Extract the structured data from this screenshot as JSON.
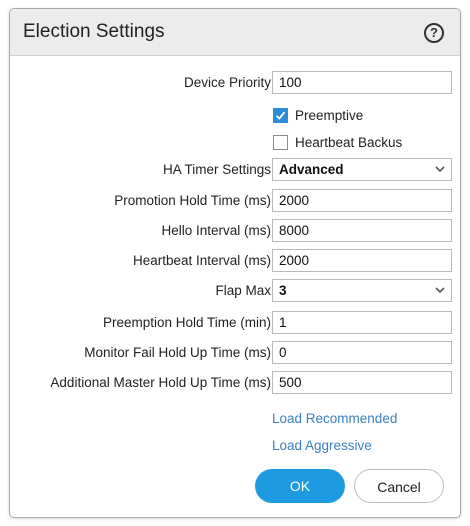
{
  "dialog": {
    "title": "Election Settings",
    "help_glyph": "?"
  },
  "fields": {
    "device_priority": {
      "label": "Device Priority",
      "value": "100"
    },
    "preemptive": {
      "label": "Preemptive",
      "checked": true
    },
    "heartbeat_backup": {
      "label": "Heartbeat Backus",
      "checked": false
    },
    "ha_timer_settings": {
      "label": "HA Timer Settings",
      "value": "Advanced"
    },
    "promotion_hold_time": {
      "label": "Promotion Hold Time (ms)",
      "value": "2000"
    },
    "hello_interval": {
      "label": "Hello Interval (ms)",
      "value": "8000"
    },
    "heartbeat_interval": {
      "label": "Heartbeat Interval (ms)",
      "value": "2000"
    },
    "flap_max": {
      "label": "Flap Max",
      "value": "3"
    },
    "preemption_hold_time": {
      "label": "Preemption Hold Time (min)",
      "value": "1"
    },
    "monitor_fail_hold_up_time": {
      "label": "Monitor Fail Hold Up Time (ms)",
      "value": "0"
    },
    "additional_master_hold_up_time": {
      "label": "Additional Master Hold Up Time (ms)",
      "value": "500"
    }
  },
  "links": {
    "load_recommended": "Load Recommended",
    "load_aggressive": "Load Aggressive"
  },
  "buttons": {
    "ok": "OK",
    "cancel": "Cancel"
  },
  "colors": {
    "primary_button": "#1e9be0",
    "link": "#3a7fc1",
    "checkbox_checked": "#2e8bd8",
    "titlebar": "#ececec"
  },
  "icons": {
    "help": "help-circle-icon",
    "dropdown": "chevron-down-icon",
    "checkmark": "checkmark-icon"
  }
}
